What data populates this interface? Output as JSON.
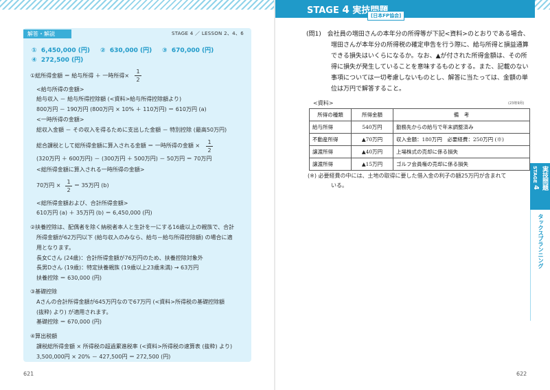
{
  "left": {
    "tab_label": "解答・解説",
    "lesson": "STAGE 4 ／ LESSON 2、4、6",
    "answers": [
      {
        "num": "①",
        "value": "6,450,000 (円)"
      },
      {
        "num": "②",
        "value": "630,000 (円)"
      },
      {
        "num": "③",
        "value": "670,000 (円)"
      },
      {
        "num": "④",
        "value": "272,500 (円)"
      }
    ],
    "frac_half_num": "1",
    "frac_half_den": "2",
    "lines": {
      "l1": "①総所得金額 ＝ 給与所得 ＋ 一時所得×",
      "l2": "<給与所得の金額>",
      "l3": "給与収入 － 給与所得控除額 (<資料>給与所得控除額より)",
      "l4": "800万円 － 190万円 (800万円 × 10% ＋ 110万円) ＝ 610万円 (a)",
      "l5": "<一時所得の金額>",
      "l6": "総収入金額 － その収入を得るために支出した金額 － 特別控除 (最高50万円)",
      "l7": "総合課税として総所得金額に算入される金額 ＝ 一時所得の金額 ×",
      "l8": "(320万円 ＋ 600万円) － (300万円 ＋ 500万円) － 50万円 ＝ 70万円",
      "l9": "<総所得金額に算入される一時所得の金額>",
      "l10a": "70万円 ×",
      "l10b": "＝ 35万円 (b)",
      "l11": "<総所得金額および、合計所得金額>",
      "l12": "610万円 (a) ＋ 35万円 (b) ＝ 6,450,000 (円)",
      "l13": "②扶養控除は、配偶者を除く納税者本人と生計を一にする16歳以上の親族で、合計",
      "l14": "所得金額が62万円以下 (給与収入のみなら、給与－給与所得控除額) の場合に適",
      "l15": "用となります。",
      "l16": "長女Cさん (24歳)：合計所得金額が76万円のため、扶養控除対象外",
      "l17": "長男Dさん (19歳)：特定扶養親族 (19歳以上23歳未満) → 63万円",
      "l18": "扶養控除 ＝ 630,000 (円)",
      "l19": "③基礎控除",
      "l20": "Aさんの合計所得金額が645万円なので67万円 (<資料>所得税の基礎控除額",
      "l21": "(抜粋) より) が適用されます。",
      "l22": "基礎控除 ＝ 670,000 (円)",
      "l23": "④算出税額",
      "l24": "課税総所得金額 × 所得税の超過累進税率 (<資料>所得税の速算表 (抜粋) より)",
      "l25": "3,500,000円 × 20% － 427,500円 ＝ 272,500 (円)"
    },
    "page_number": "621"
  },
  "right": {
    "stage_prefix": "STAGE",
    "stage_num": "4",
    "stage_title": "実技問題",
    "org": "[日本FP協会]",
    "question_lines": [
      "(問1)　会社員の増田さんの本年分の所得等が下記<資料>のとおりである場合、",
      "増田さんが本年分の所得税の確定申告を行う際に、給与所得と損益通算",
      "できる損失はいくらになるか。なお、▲が付された所得金額は、その所",
      "得に損失が発生していることを意味するものとする。また、記載のない",
      "事項については一切考慮しないものとし、解答に当たっては、金額の単",
      "位は万円で解答すること。"
    ],
    "resource_label": "<資料>",
    "resource_date": "(23年9月)",
    "table": {
      "headers": [
        "所得の種類",
        "所得金額",
        "備　考"
      ],
      "rows": [
        [
          "給与所得",
          "540万円",
          "勤務先からの給与で年末調整済み"
        ],
        [
          "不動産所得",
          "▲70万円",
          "収入金額：180万円　必要経費：250万円 (※)"
        ],
        [
          "譲渡所得",
          "▲40万円",
          "上場株式の売却に係る損失"
        ],
        [
          "譲渡所得",
          "▲15万円",
          "ゴルフ会員権の売却に係る損失"
        ]
      ]
    },
    "note_lines": [
      "(※) 必要経費の中には、土地の取得に要した借入金の利子の額25万円が含まれて",
      "いる。"
    ],
    "side_tab": {
      "stage": "STAGE",
      "num": "4",
      "title": "実技問題",
      "subtitle": "タックスプランニング"
    },
    "page_number": "622"
  }
}
